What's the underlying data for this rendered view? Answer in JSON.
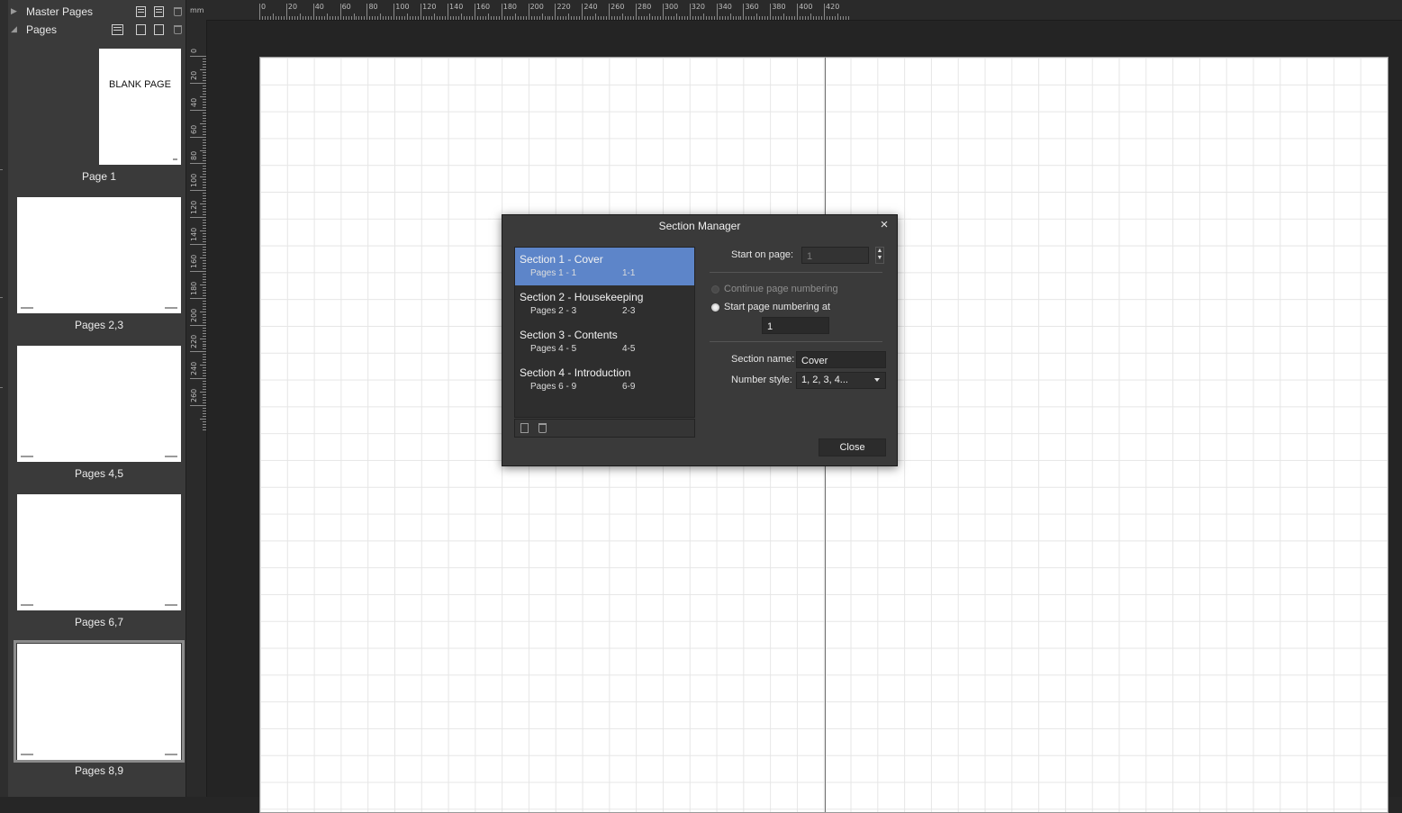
{
  "ruler": {
    "unit": "mm",
    "h_labels": [
      "0",
      "20",
      "40",
      "60",
      "80",
      "100",
      "120",
      "140",
      "160",
      "180",
      "200",
      "220",
      "240",
      "260",
      "280",
      "300",
      "320",
      "340",
      "360",
      "380",
      "400",
      "420"
    ],
    "v_labels": [
      "0",
      "20",
      "40",
      "60",
      "80",
      "100",
      "120",
      "140",
      "160",
      "180",
      "200",
      "220",
      "240",
      "260"
    ]
  },
  "panel": {
    "master_pages_label": "Master Pages",
    "pages_label": "Pages",
    "thumbnails": [
      {
        "label": "Page 1",
        "content": "BLANK PAGE"
      },
      {
        "label": "Pages 2,3"
      },
      {
        "label": "Pages 4,5"
      },
      {
        "label": "Pages 6,7"
      },
      {
        "label": "Pages 8,9",
        "selected": true
      }
    ]
  },
  "dialog": {
    "title": "Section Manager",
    "close_icon": "×",
    "sections": [
      {
        "name": "Section 1 - Cover",
        "pages": "Pages 1 - 1",
        "range": "1-1",
        "selected": true
      },
      {
        "name": "Section 2 - Housekeeping",
        "pages": "Pages 2 - 3",
        "range": "2-3"
      },
      {
        "name": "Section 3 - Contents",
        "pages": "Pages 4 - 5",
        "range": "4-5"
      },
      {
        "name": "Section 4 - Introduction",
        "pages": "Pages 6 - 9",
        "range": "6-9"
      }
    ],
    "start_on_page_label": "Start on page:",
    "start_on_page_value": "1",
    "continue_numbering_label": "Continue page numbering",
    "start_numbering_label": "Start page numbering at",
    "start_numbering_value": "1",
    "section_name_label": "Section name:",
    "section_name_value": "Cover",
    "number_style_label": "Number style:",
    "number_style_value": "1, 2, 3, 4...",
    "close_label": "Close",
    "stepper_up": "▲",
    "stepper_down": "▼"
  },
  "colors": {
    "accent": "#5d85c9",
    "canvas": "#242424",
    "panel": "#3a3a3a"
  }
}
